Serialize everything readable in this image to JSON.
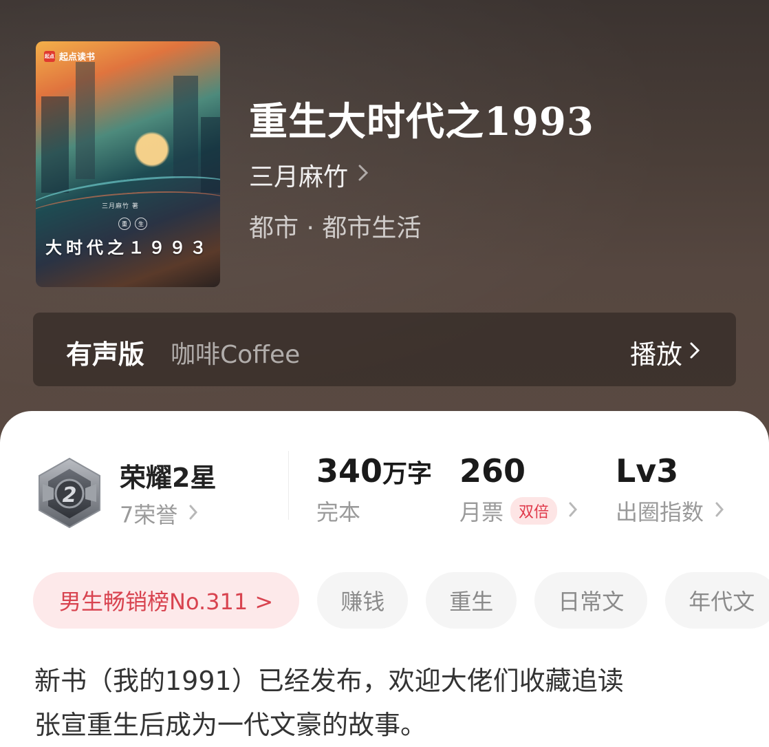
{
  "book": {
    "title": "重生大时代之1993",
    "author": "三月麻竹",
    "category": "都市 · 都市生活",
    "cover": {
      "logo_text": "起点读书",
      "logo_mark": "起点",
      "author": "三月麻竹 著",
      "seal": [
        "重",
        "生"
      ],
      "title": "大时代之１９９３"
    }
  },
  "audio": {
    "label": "有声版",
    "narrator": "咖啡Coffee",
    "play_label": "播放"
  },
  "stats": {
    "honor": {
      "title": "荣耀2星",
      "sub": "7荣誉",
      "badge_number": "2"
    },
    "words": {
      "value": "340",
      "unit": "万字",
      "label": "完本"
    },
    "votes": {
      "value": "260",
      "label": "月票",
      "tag": "双倍"
    },
    "level": {
      "value": "Lv3",
      "label": "出圈指数"
    }
  },
  "chips": {
    "rank": "男生畅销榜No.311 >",
    "tags": [
      "赚钱",
      "重生",
      "日常文",
      "年代文"
    ]
  },
  "description": {
    "line1": "新书（我的1991）已经发布，欢迎大佬们收藏追读",
    "line2": "张宣重生后成为一代文豪的故事。"
  },
  "colors": {
    "accent_red": "#d8434f",
    "hero_bg": "#4a3e38"
  }
}
